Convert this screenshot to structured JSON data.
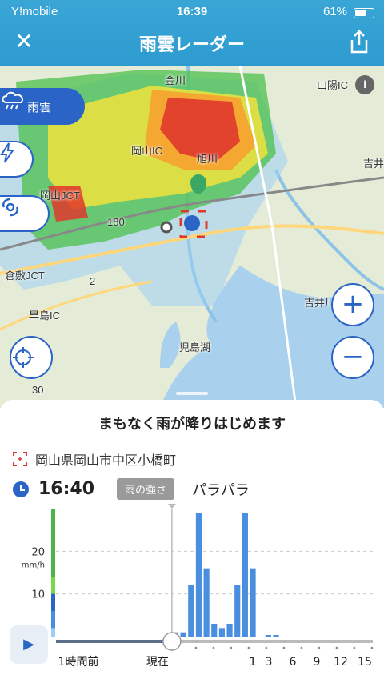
{
  "status": {
    "carrier": "Y!mobile",
    "time": "16:39",
    "battery_pct": "61%",
    "battery_level": 0.61
  },
  "header": {
    "title": "雨雲レーダー",
    "close": "✕"
  },
  "map": {
    "labels": [
      "金川",
      "山陽IC",
      "岡山IC",
      "旭川",
      "吉井",
      "岡山JCT",
      "180",
      "倉敷JCT",
      "2",
      "吉井川",
      "早島IC",
      "児島湖",
      "30"
    ],
    "layers": [
      "雨雲"
    ]
  },
  "controls": {
    "zoom_in": "+",
    "zoom_out": "−"
  },
  "sheet": {
    "headline": "まもなく雨が降りはじめます",
    "address": "岡山県岡山市中区小橋町",
    "time": "16:40",
    "badge": "雨の強さ",
    "intensity": "パラパラ"
  },
  "chart_data": {
    "type": "bar",
    "ylabel": "mm/h",
    "yticks": [
      10,
      20
    ],
    "ylim": [
      0,
      30
    ],
    "xlabels": [
      "1時間前",
      "現在",
      "1",
      "3",
      "6",
      "9",
      "12",
      "15"
    ],
    "values": [
      0,
      0,
      0,
      0,
      0,
      0,
      0,
      0,
      0,
      0,
      0,
      0,
      0,
      0,
      0,
      1,
      1,
      12,
      29,
      16,
      3,
      2,
      3,
      12,
      29,
      16,
      0,
      0.3,
      0.3,
      0,
      0,
      0,
      0,
      0,
      0,
      0,
      0,
      0,
      0,
      0,
      0
    ],
    "now_index": 14
  },
  "colors": {
    "accent": "#2a64c6",
    "header": "#2d9bd0",
    "bar": "#4a8ee0"
  }
}
